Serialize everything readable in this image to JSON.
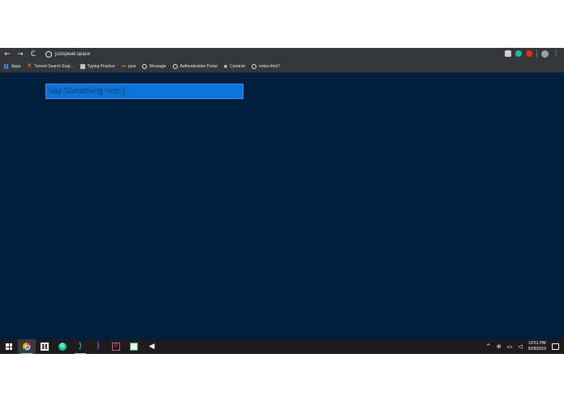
{
  "browser": {
    "url": "justspeak.space",
    "nav": {
      "back": "←",
      "forward": "→",
      "reload": "C"
    },
    "menu": "⋮"
  },
  "bookmarks": [
    {
      "label": "Apps",
      "icon": "apps-grid-icon"
    },
    {
      "label": "Torrent Search Engi...",
      "icon": "x-icon"
    },
    {
      "label": "Typing Practice",
      "icon": "document-icon"
    },
    {
      "label": "java",
      "icon": "java-icon"
    },
    {
      "label": "Message",
      "icon": "globe-icon"
    },
    {
      "label": "Authentication Portal",
      "icon": "globe-icon"
    },
    {
      "label": "Crestron",
      "icon": "eye-icon"
    },
    {
      "label": "index.html?",
      "icon": "globe-icon"
    }
  ],
  "page": {
    "background": "#001f3f",
    "input_placeholder": "Say Something nice:)",
    "input_color": "#0a74da"
  },
  "taskbar": {
    "h_label": "H",
    "g_label": "G",
    "vs_label": "⟩",
    "vs2_label": "⟩",
    "pt_label": "P",
    "speaker": "◀",
    "tray": {
      "chevron": "^",
      "network": "⊕",
      "battery": "▭",
      "volume": "◁"
    },
    "time": "10:51 PM",
    "date": "9/28/2019"
  }
}
